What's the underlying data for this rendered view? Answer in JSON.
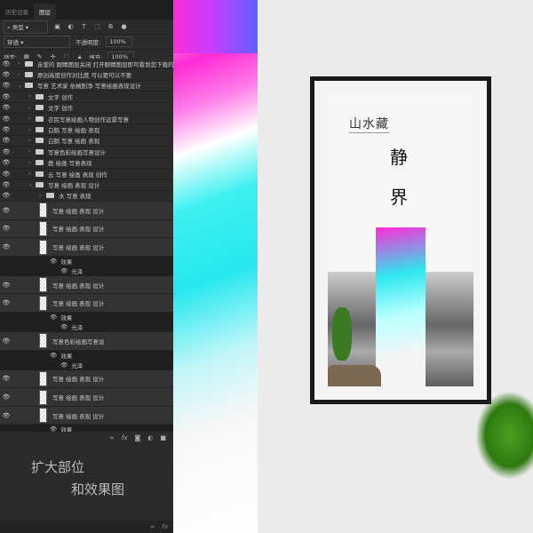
{
  "panel": {
    "tabs": [
      {
        "label": "历史记录"
      },
      {
        "label": "图层"
      }
    ],
    "filter_label": "类型",
    "blend_mode": "穿透",
    "opacity_label": "不透明度:",
    "opacity_value": "100%",
    "lock_label": "锁定:",
    "fill_label": "填充:",
    "fill_value": "100%",
    "layers": [
      {
        "type": "folder",
        "indent": 0,
        "name": "亲爱的 眼睛图层关闭 打开眼睛图层即可看到您下载的方"
      },
      {
        "type": "folder",
        "indent": 0,
        "name": "原创高度创作对比度 可以要可以不要"
      },
      {
        "type": "folder",
        "indent": 0,
        "open": true,
        "name": "写意 艺术家 依械削净 写意绘画表现设计"
      },
      {
        "type": "folder",
        "indent": 1,
        "name": "文字 创作"
      },
      {
        "type": "folder",
        "indent": 1,
        "name": "文字 创作"
      },
      {
        "type": "folder",
        "indent": 1,
        "name": "农民写意绘画人物创作远景写意"
      },
      {
        "type": "folder",
        "indent": 1,
        "name": "白鹅 写意 绘画 表现"
      },
      {
        "type": "folder",
        "indent": 1,
        "name": "白鹅 写意 绘画 表现"
      },
      {
        "type": "folder",
        "indent": 1,
        "name": "写意色彩绘画写意设计"
      },
      {
        "type": "folder",
        "indent": 1,
        "name": "鹿 绘画 写意表现"
      },
      {
        "type": "folder",
        "indent": 1,
        "name": "云 写意 绘画 表现 创作"
      },
      {
        "type": "folder",
        "indent": 1,
        "open": true,
        "name": "写意 绘画 表现 设计"
      },
      {
        "type": "folder",
        "indent": 2,
        "name": "水 写意 表现"
      },
      {
        "type": "layer",
        "indent": 2,
        "name": "写意 绘画 表现 设计"
      },
      {
        "type": "layer",
        "indent": 2,
        "name": "写意 绘画 表现 设计"
      },
      {
        "type": "layer",
        "indent": 2,
        "name": "写意 绘画 表现 设计"
      },
      {
        "type": "fx",
        "indent": 3,
        "name": "效果"
      },
      {
        "type": "fx",
        "indent": 4,
        "name": "光泽"
      },
      {
        "type": "layer",
        "indent": 2,
        "name": "写意 绘画 表现 设计"
      },
      {
        "type": "layer",
        "indent": 2,
        "name": "写意 绘画 表现 设计"
      },
      {
        "type": "fx",
        "indent": 3,
        "name": "效果"
      },
      {
        "type": "fx",
        "indent": 4,
        "name": "光泽"
      },
      {
        "type": "layer",
        "indent": 2,
        "name": "写意色彩绘画写意设"
      },
      {
        "type": "fx",
        "indent": 3,
        "name": "效果"
      },
      {
        "type": "fx",
        "indent": 4,
        "name": "光泽"
      },
      {
        "type": "layer",
        "indent": 2,
        "name": "写意 绘画 表现 设计"
      },
      {
        "type": "layer",
        "indent": 2,
        "name": "写意 绘画 表现 设计"
      },
      {
        "type": "layer",
        "indent": 2,
        "name": "写意 绘画 表现 设计"
      },
      {
        "type": "fx",
        "indent": 3,
        "name": "效果"
      }
    ],
    "bottom_icons": [
      "link-icon",
      "fx-icon",
      "mask-icon",
      "adjustment-icon",
      "folder-icon"
    ]
  },
  "caption": {
    "line1": "扩大部位",
    "line2": "和效果图"
  },
  "poster": {
    "title": "山水藏",
    "vertical1": "静",
    "vertical2": "界"
  },
  "colors": {
    "magenta": "#ff2bd6",
    "cyan": "#2ee8ee",
    "panel": "#2b2b2b"
  }
}
